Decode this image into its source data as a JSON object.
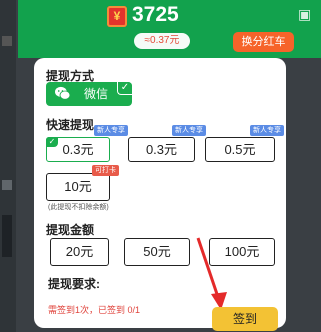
{
  "header": {
    "coin_symbol": "¥",
    "coins": "3725",
    "cash_equivalent": "≈0.37元",
    "exchange_button": "换分红车"
  },
  "withdraw_method": {
    "title": "提现方式",
    "option": "微信",
    "check": "✓"
  },
  "quick_withdraw": {
    "title": "快速提现",
    "options": [
      {
        "amount": "0.3元",
        "badge": "新人专享",
        "selected": true
      },
      {
        "amount": "0.3元",
        "badge": "新人专享"
      },
      {
        "amount": "0.5元",
        "badge": "新人专享"
      },
      {
        "amount": "10元",
        "badge": "可打卡"
      }
    ],
    "note": "(此提现不扣除余额)"
  },
  "withdraw_amount": {
    "title": "提现金额",
    "options": [
      "20元",
      "50元",
      "100元"
    ]
  },
  "requirement": {
    "title": "提现要求:",
    "text": "需签到1次，已签到 0/1"
  },
  "sign_button": "签到",
  "colors": {
    "green": "#12a24d",
    "orange": "#f6632a",
    "yellow": "#f3c234",
    "badge_blue": "#5b8ce5",
    "badge_red": "#e85b4a"
  }
}
